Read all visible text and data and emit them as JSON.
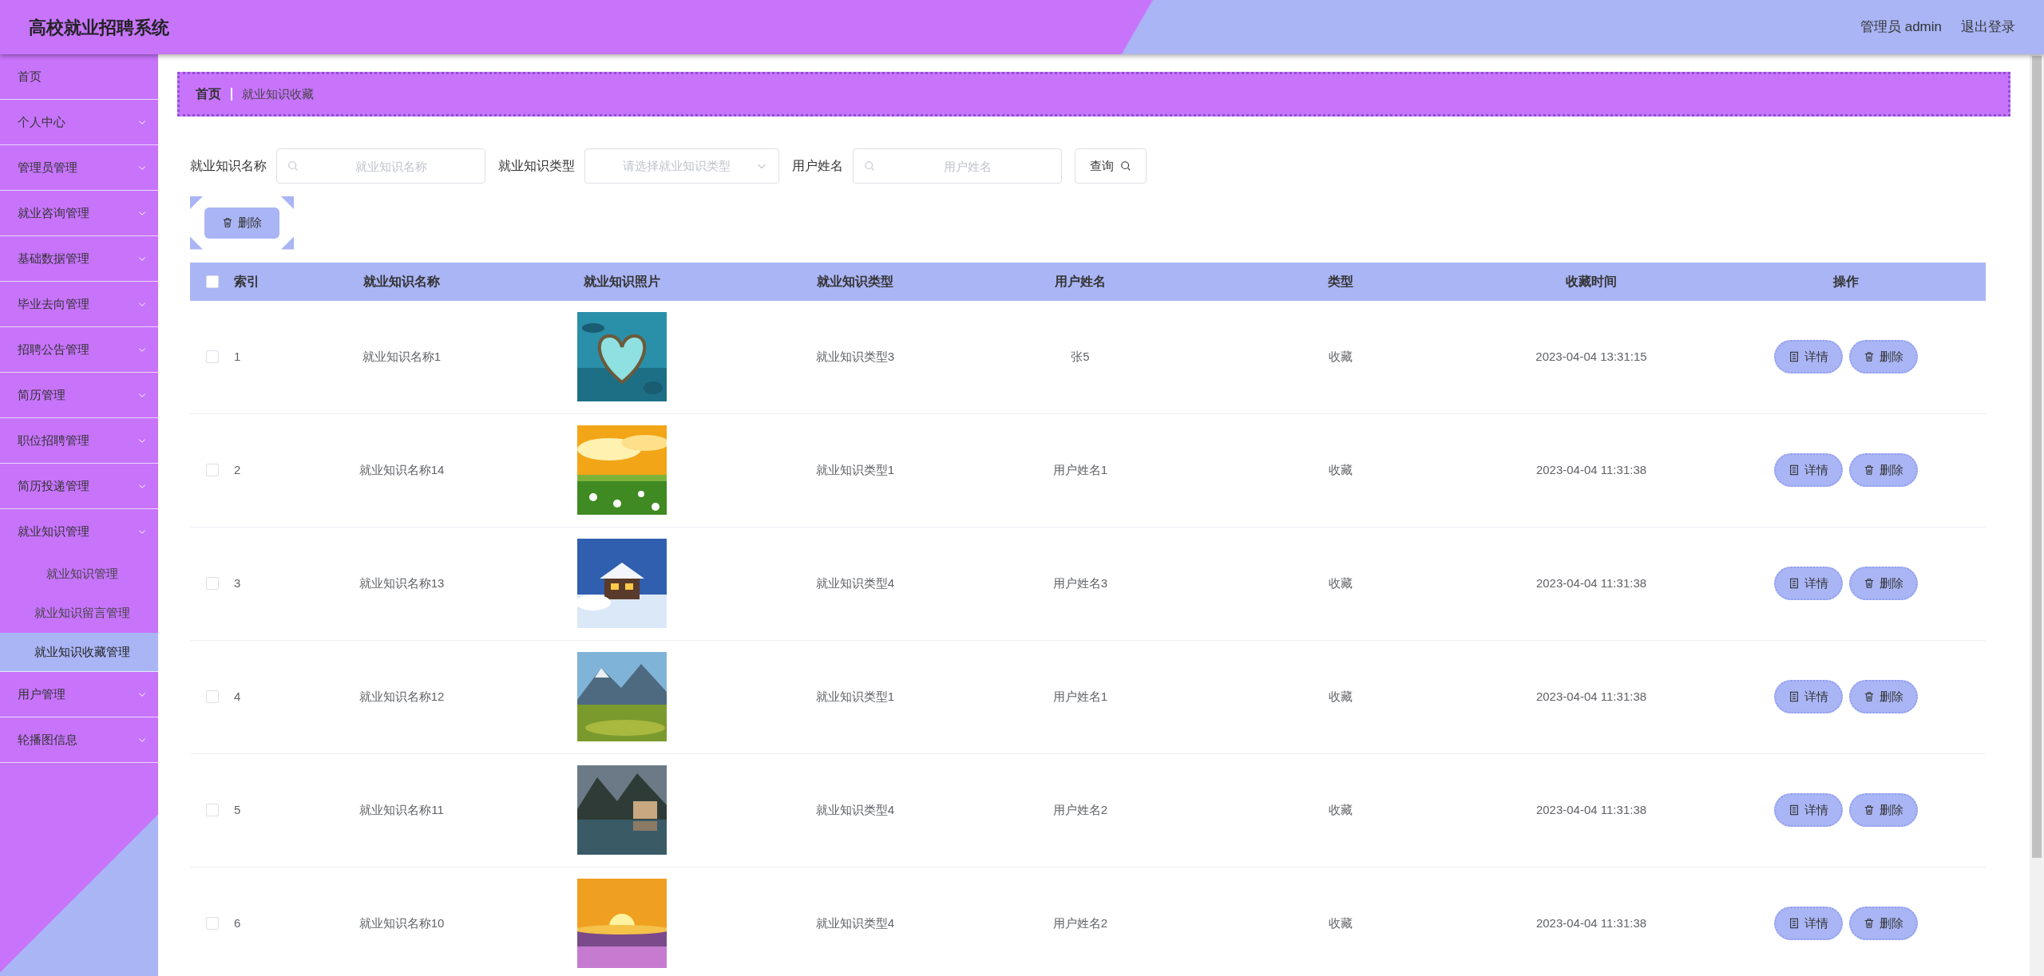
{
  "header": {
    "title": "高校就业招聘系统",
    "user": "管理员 admin",
    "logout": "退出登录"
  },
  "sidebar": {
    "items": [
      {
        "label": "首页",
        "has_arrow": false,
        "expanded": false
      },
      {
        "label": "个人中心",
        "has_arrow": true,
        "expanded": false
      },
      {
        "label": "管理员管理",
        "has_arrow": true,
        "expanded": false
      },
      {
        "label": "就业咨询管理",
        "has_arrow": true,
        "expanded": false
      },
      {
        "label": "基础数据管理",
        "has_arrow": true,
        "expanded": false
      },
      {
        "label": "毕业去向管理",
        "has_arrow": true,
        "expanded": false
      },
      {
        "label": "招聘公告管理",
        "has_arrow": true,
        "expanded": false
      },
      {
        "label": "简历管理",
        "has_arrow": true,
        "expanded": false
      },
      {
        "label": "职位招聘管理",
        "has_arrow": true,
        "expanded": false
      },
      {
        "label": "简历投递管理",
        "has_arrow": true,
        "expanded": false
      },
      {
        "label": "就业知识管理",
        "has_arrow": true,
        "expanded": true,
        "children": [
          {
            "label": "就业知识管理",
            "selected": false
          },
          {
            "label": "就业知识留言管理",
            "selected": false
          },
          {
            "label": "就业知识收藏管理",
            "selected": true
          }
        ]
      },
      {
        "label": "用户管理",
        "has_arrow": true,
        "expanded": false
      },
      {
        "label": "轮播图信息",
        "has_arrow": true,
        "expanded": false
      }
    ]
  },
  "breadcrumb": [
    "首页",
    "就业知识收藏"
  ],
  "filters": [
    {
      "kind": "search",
      "label": "就业知识名称",
      "placeholder": "就业知识名称"
    },
    {
      "kind": "select",
      "label": "就业知识类型",
      "placeholder": "请选择就业知识类型"
    },
    {
      "kind": "search",
      "label": "用户姓名",
      "placeholder": "用户姓名"
    }
  ],
  "query_button": "查询",
  "delete_button": "删除",
  "table": {
    "select_all_checked": false,
    "columns": [
      "索引",
      "就业知识名称",
      "就业知识照片",
      "就业知识类型",
      "用户姓名",
      "类型",
      "收藏时间",
      "操作"
    ],
    "rows": [
      {
        "checked": false,
        "index": "1",
        "name": "就业知识名称1",
        "photo": {
          "kind": "picture"
        },
        "type": "就业知识类型3",
        "user": "张5",
        "kind": "收藏",
        "time": "2023-04-04 13:31:15",
        "actions": [
          "详情",
          "删除"
        ]
      },
      {
        "checked": false,
        "index": "2",
        "name": "就业知识名称14",
        "photo": {
          "kind": "picture"
        },
        "type": "就业知识类型1",
        "user": "用户姓名1",
        "kind": "收藏",
        "time": "2023-04-04 11:31:38",
        "actions": [
          "详情",
          "删除"
        ]
      },
      {
        "checked": false,
        "index": "3",
        "name": "就业知识名称13",
        "photo": {
          "kind": "picture"
        },
        "type": "就业知识类型4",
        "user": "用户姓名3",
        "kind": "收藏",
        "time": "2023-04-04 11:31:38",
        "actions": [
          "详情",
          "删除"
        ]
      },
      {
        "checked": false,
        "index": "4",
        "name": "就业知识名称12",
        "photo": {
          "kind": "picture"
        },
        "type": "就业知识类型1",
        "user": "用户姓名1",
        "kind": "收藏",
        "time": "2023-04-04 11:31:38",
        "actions": [
          "详情",
          "删除"
        ]
      },
      {
        "checked": false,
        "index": "5",
        "name": "就业知识名称11",
        "photo": {
          "kind": "picture"
        },
        "type": "就业知识类型4",
        "user": "用户姓名2",
        "kind": "收藏",
        "time": "2023-04-04 11:31:38",
        "actions": [
          "详情",
          "删除"
        ]
      },
      {
        "checked": false,
        "index": "6",
        "name": "就业知识名称10",
        "photo": {
          "kind": "picture"
        },
        "type": "就业知识类型4",
        "user": "用户姓名2",
        "kind": "收藏",
        "time": "2023-04-04 11:31:38",
        "actions": [
          "详情",
          "删除"
        ]
      }
    ]
  }
}
